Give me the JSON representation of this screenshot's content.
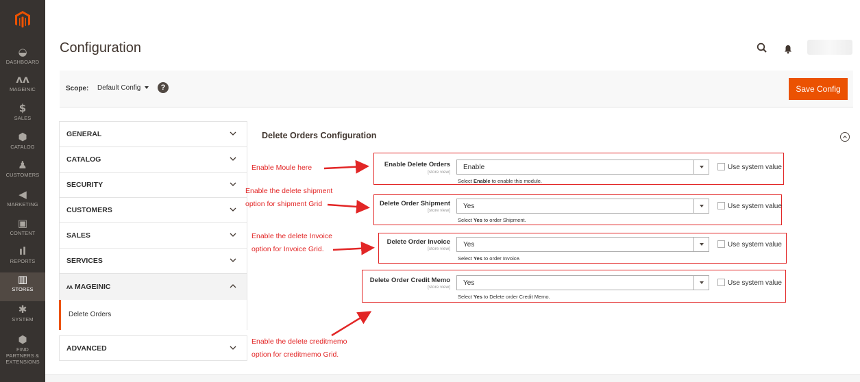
{
  "sidebar": {
    "items": [
      {
        "label": "DASHBOARD",
        "icon": "dashboard-icon"
      },
      {
        "label": "MAGEINIC",
        "icon": "mageinic-icon"
      },
      {
        "label": "SALES",
        "icon": "dollar-icon"
      },
      {
        "label": "CATALOG",
        "icon": "cube-icon"
      },
      {
        "label": "CUSTOMERS",
        "icon": "person-icon"
      },
      {
        "label": "MARKETING",
        "icon": "megaphone-icon"
      },
      {
        "label": "CONTENT",
        "icon": "layout-icon"
      },
      {
        "label": "REPORTS",
        "icon": "bar-chart-icon"
      },
      {
        "label": "STORES",
        "icon": "store-icon"
      },
      {
        "label": "SYSTEM",
        "icon": "gear-icon"
      },
      {
        "label": "FIND PARTNERS & EXTENSIONS",
        "icon": "box-icon"
      }
    ],
    "active": "STORES"
  },
  "header": {
    "title": "Configuration"
  },
  "scope": {
    "label": "Scope:",
    "value": "Default Config",
    "help": "?"
  },
  "toolbar": {
    "save_label": "Save Config"
  },
  "tabs": {
    "general": "GENERAL",
    "catalog": "CATALOG",
    "security": "SECURITY",
    "customers": "CUSTOMERS",
    "sales": "SALES",
    "services": "SERVICES",
    "mageinic": "MAGEINIC",
    "delete_orders": "Delete Orders",
    "advanced": "ADVANCED"
  },
  "section": {
    "title": "Delete Orders Configuration"
  },
  "fields": [
    {
      "label": "Enable Delete Orders",
      "scope": "[store view]",
      "value": "Enable",
      "note_pre": "Select ",
      "note_bold": "Enable",
      "note_post": " to enable this module.",
      "use_system": "Use system value"
    },
    {
      "label": "Delete Order Shipment",
      "scope": "[store view]",
      "value": "Yes",
      "note_pre": "Select ",
      "note_bold": "Yes",
      "note_post": " to order Shipment.",
      "use_system": "Use system value"
    },
    {
      "label": "Delete Order Invoice",
      "scope": "[store view]",
      "value": "Yes",
      "note_pre": "Select ",
      "note_bold": "Yes",
      "note_post": " to order Invoice.",
      "use_system": "Use system value"
    },
    {
      "label": "Delete Order Credit Memo",
      "scope": "[store view]",
      "value": "Yes",
      "note_pre": "Select ",
      "note_bold": "Yes",
      "note_post": " to Delete order Credit Memo.",
      "use_system": "Use system value"
    }
  ],
  "annotations": {
    "a1": "Enable Moule here",
    "a2_line1": "Enable  the delete shipment",
    "a2_line2": "option for shipment Grid",
    "a3_line1": "Enable  the delete Invoice",
    "a3_line2": "option for Invoice Grid.",
    "a4_line1": "Enable  the delete creditmemo",
    "a4_line2": "option for creditmemo Grid."
  },
  "colors": {
    "accent": "#eb5202",
    "sidebar": "#373330",
    "annotation": "#e22626"
  }
}
